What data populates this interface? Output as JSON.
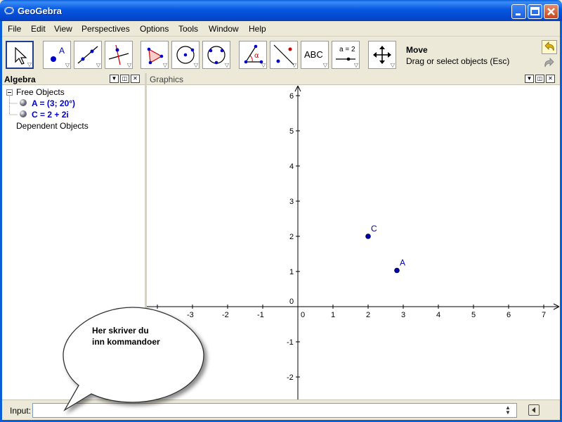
{
  "window": {
    "title": "GeoGebra",
    "minimize": "_",
    "maximize": "□",
    "close": "✕"
  },
  "menu": [
    "File",
    "Edit",
    "View",
    "Perspectives",
    "Options",
    "Tools",
    "Window",
    "Help"
  ],
  "toolbar": {
    "active_tool_name": "Move",
    "active_tool_desc": "Drag or select objects (Esc)",
    "text_tool_label": "ABC",
    "slider_tool_label": "a = 2",
    "tools": [
      "move-tool",
      "point-tool",
      "line-tool",
      "perpendicular-tool",
      "polygon-tool",
      "circle-tool",
      "conic-tool",
      "angle-tool",
      "reflect-tool",
      "text-tool",
      "slider-tool",
      "move-view-tool"
    ]
  },
  "algebra": {
    "title": "Algebra",
    "free_objects": "Free Objects",
    "objects": [
      "A = (3; 20°)",
      "C = 2 + 2i"
    ],
    "dependent_objects": "Dependent Objects"
  },
  "graphics": {
    "title": "Graphics",
    "x_ticks": [
      "-3",
      "-2",
      "-1",
      "0",
      "1",
      "2",
      "3",
      "4",
      "5",
      "6",
      "7"
    ],
    "y_ticks": [
      "6",
      "5",
      "4",
      "3",
      "2",
      "1",
      "0",
      "-1",
      "-2"
    ],
    "points": [
      {
        "label": "C",
        "x": 2,
        "y": 2
      },
      {
        "label": "A",
        "x": 2.82,
        "y": 1.03
      }
    ],
    "point_color": "#0000aa"
  },
  "input": {
    "label": "Input:",
    "value": ""
  },
  "callout": {
    "line1": "Her skriver du",
    "line2": "inn kommandoer"
  }
}
